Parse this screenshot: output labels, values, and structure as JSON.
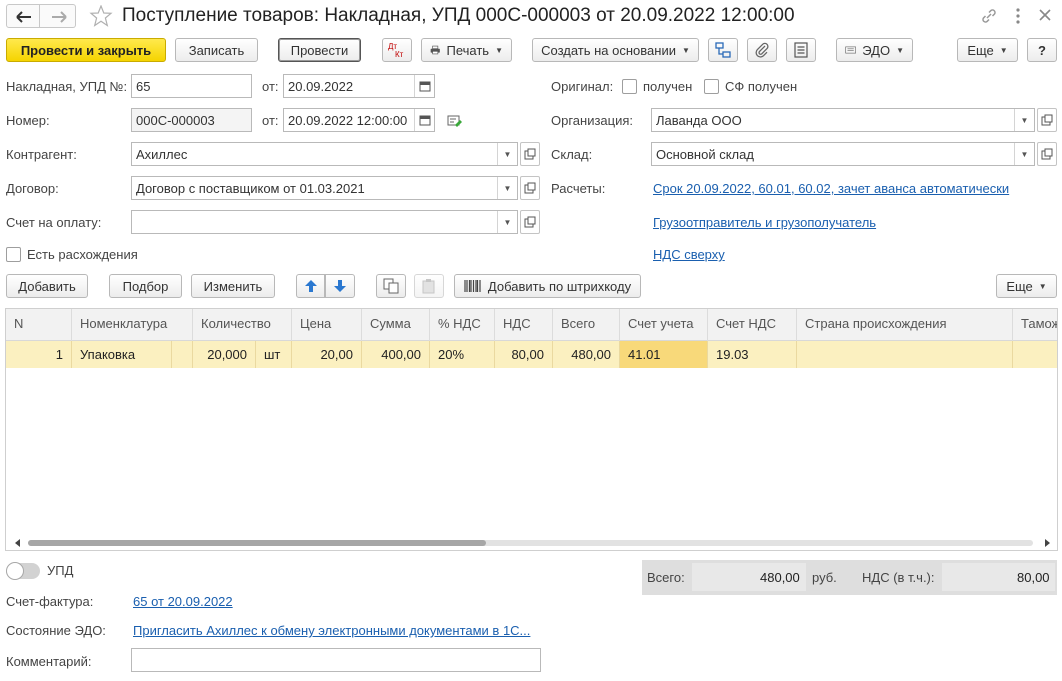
{
  "title": "Поступление товаров: Накладная, УПД 000С-000003 от 20.09.2022 12:00:00",
  "toolbar": {
    "post_close": "Провести и закрыть",
    "save": "Записать",
    "post": "Провести",
    "dtkt_top": "Дт",
    "dtkt_bottom": "Кт",
    "print": "Печать",
    "create_based": "Создать на основании",
    "edo": "ЭДО",
    "more": "Еще",
    "help": "?"
  },
  "form": {
    "invoice_no_label": "Накладная, УПД №:",
    "invoice_no_value": "65",
    "from_label": "от:",
    "invoice_date": "20.09.2022",
    "number_label": "Номер:",
    "number_value": "000С-000003",
    "number_date": "20.09.2022 12:00:00",
    "counterparty_label": "Контрагент:",
    "counterparty_value": "Ахиллес",
    "contract_label": "Договор:",
    "contract_value": "Договор с поставщиком от 01.03.2021",
    "payment_label": "Счет на оплату:",
    "payment_value": "",
    "discrepancy_label": "Есть расхождения",
    "original_label": "Оригинал:",
    "received_label": "получен",
    "sf_received_label": "СФ получен",
    "org_label": "Организация:",
    "org_value": "Лаванда ООО",
    "warehouse_label": "Склад:",
    "warehouse_value": "Основной склад",
    "settlements_label": "Расчеты:",
    "settlements_link": "Срок 20.09.2022, 60.01, 60.02, зачет аванса автоматически",
    "shipper_link": "Грузоотправитель и грузополучатель",
    "vat_link": "НДС сверху"
  },
  "table_toolbar": {
    "add": "Добавить",
    "pick": "Подбор",
    "change": "Изменить",
    "add_barcode": "Добавить по штрихкоду",
    "more": "Еще"
  },
  "table": {
    "headers": [
      "N",
      "Номенклатура",
      "Количество",
      "Цена",
      "Сумма",
      "% НДС",
      "НДС",
      "Всего",
      "Счет учета",
      "Счет НДС",
      "Страна происхождения",
      "Тамож"
    ],
    "rows": [
      {
        "n": "1",
        "item": "Упаковка",
        "qty": "20,000",
        "unit": "шт",
        "price": "20,00",
        "sum": "400,00",
        "vat_rate": "20%",
        "vat": "80,00",
        "total": "480,00",
        "account": "41.01",
        "vat_account": "19.03",
        "country": "",
        "customs": ""
      }
    ]
  },
  "footer": {
    "upd_label": "УПД",
    "upd_toggle_on": false,
    "total_label": "Всего:",
    "total_value": "480,00",
    "currency": "руб.",
    "vat_label": "НДС (в т.ч.):",
    "vat_value": "80,00",
    "invoice_label": "Счет-фактура:",
    "invoice_link": "65 от 20.09.2022",
    "edo_state_label": "Состояние ЭДО:",
    "edo_state_link": "Пригласить Ахиллес к обмену электронными документами в 1С...",
    "comment_label": "Комментарий:",
    "comment_value": ""
  }
}
